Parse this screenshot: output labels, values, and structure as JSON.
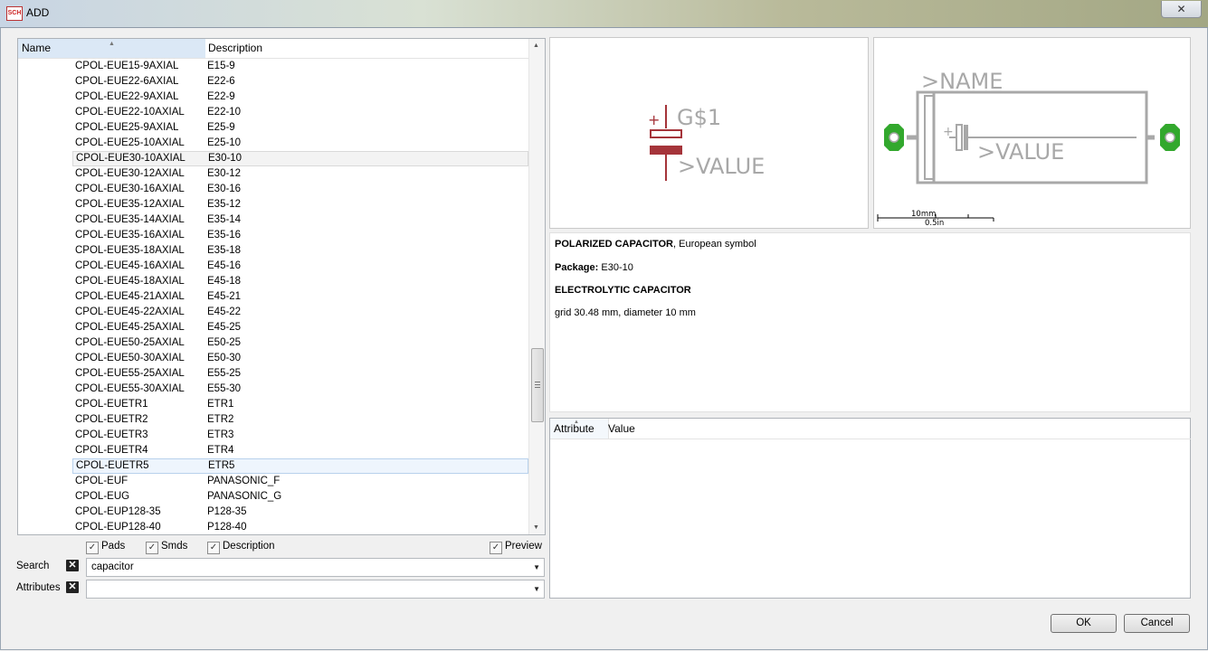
{
  "window": {
    "title": "ADD",
    "app_icon_text": "SCH",
    "close_glyph": "✕"
  },
  "list": {
    "headers": {
      "name": "Name",
      "description": "Description"
    },
    "rows": [
      {
        "name": "CPOL-EUE15-9AXIAL",
        "desc": "E15-9"
      },
      {
        "name": "CPOL-EUE22-6AXIAL",
        "desc": "E22-6"
      },
      {
        "name": "CPOL-EUE22-9AXIAL",
        "desc": "E22-9"
      },
      {
        "name": "CPOL-EUE22-10AXIAL",
        "desc": "E22-10"
      },
      {
        "name": "CPOL-EUE25-9AXIAL",
        "desc": "E25-9"
      },
      {
        "name": "CPOL-EUE25-10AXIAL",
        "desc": "E25-10"
      },
      {
        "name": "CPOL-EUE30-10AXIAL",
        "desc": "E30-10"
      },
      {
        "name": "CPOL-EUE30-12AXIAL",
        "desc": "E30-12"
      },
      {
        "name": "CPOL-EUE30-16AXIAL",
        "desc": "E30-16"
      },
      {
        "name": "CPOL-EUE35-12AXIAL",
        "desc": "E35-12"
      },
      {
        "name": "CPOL-EUE35-14AXIAL",
        "desc": "E35-14"
      },
      {
        "name": "CPOL-EUE35-16AXIAL",
        "desc": "E35-16"
      },
      {
        "name": "CPOL-EUE35-18AXIAL",
        "desc": "E35-18"
      },
      {
        "name": "CPOL-EUE45-16AXIAL",
        "desc": "E45-16"
      },
      {
        "name": "CPOL-EUE45-18AXIAL",
        "desc": "E45-18"
      },
      {
        "name": "CPOL-EUE45-21AXIAL",
        "desc": "E45-21"
      },
      {
        "name": "CPOL-EUE45-22AXIAL",
        "desc": "E45-22"
      },
      {
        "name": "CPOL-EUE45-25AXIAL",
        "desc": "E45-25"
      },
      {
        "name": "CPOL-EUE50-25AXIAL",
        "desc": "E50-25"
      },
      {
        "name": "CPOL-EUE50-30AXIAL",
        "desc": "E50-30"
      },
      {
        "name": "CPOL-EUE55-25AXIAL",
        "desc": "E55-25"
      },
      {
        "name": "CPOL-EUE55-30AXIAL",
        "desc": "E55-30"
      },
      {
        "name": "CPOL-EUETR1",
        "desc": "ETR1"
      },
      {
        "name": "CPOL-EUETR2",
        "desc": "ETR2"
      },
      {
        "name": "CPOL-EUETR3",
        "desc": "ETR3"
      },
      {
        "name": "CPOL-EUETR4",
        "desc": "ETR4"
      },
      {
        "name": "CPOL-EUETR5",
        "desc": "ETR5"
      },
      {
        "name": "CPOL-EUF",
        "desc": "PANASONIC_F"
      },
      {
        "name": "CPOL-EUG",
        "desc": "PANASONIC_G"
      },
      {
        "name": "CPOL-EUP128-35",
        "desc": "P128-35"
      },
      {
        "name": "CPOL-EUP128-40",
        "desc": "P128-40"
      }
    ],
    "selected_name": "CPOL-EUE30-10AXIAL",
    "hovered_name": "CPOL-EUETR5"
  },
  "filters": {
    "pads": {
      "label": "Pads",
      "checked": true
    },
    "smds": {
      "label": "Smds",
      "checked": true
    },
    "description": {
      "label": "Description",
      "checked": true
    },
    "preview": {
      "label": "Preview",
      "checked": true
    },
    "search_label": "Search",
    "search_value": "capacitor",
    "attributes_label": "Attributes",
    "attributes_value": ""
  },
  "symbol_preview": {
    "name_text": "G$1",
    "value_text": ">VALUE",
    "plus": "+"
  },
  "package_preview": {
    "name_text": ">NAME",
    "value_text": ">VALUE",
    "plus": "+",
    "scale_mm": "10mm",
    "scale_in": "0.5in"
  },
  "description": {
    "title_bold": "POLARIZED CAPACITOR",
    "title_rest": ", European symbol",
    "package_label": "Package:",
    "package_value": "E30-10",
    "subtitle": "ELECTROLYTIC CAPACITOR",
    "details": "grid 30.48 mm, diameter 10 mm"
  },
  "attributes": {
    "headers": {
      "attribute": "Attribute",
      "value": "Value"
    }
  },
  "buttons": {
    "ok": "OK",
    "cancel": "Cancel"
  },
  "colors": {
    "symbol_red": "#a5343a",
    "pad_green": "#32a82d",
    "silk_gray": "#a8a8a8",
    "selection": "#eef5fd"
  }
}
